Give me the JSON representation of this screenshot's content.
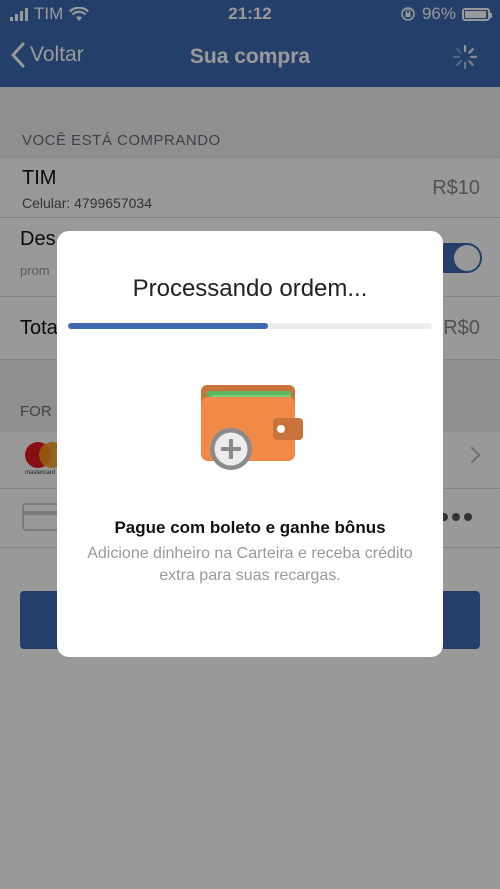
{
  "status_bar": {
    "carrier": "TIM",
    "time": "21:12",
    "battery": "96%"
  },
  "nav": {
    "back_label": "Voltar",
    "title": "Sua compra"
  },
  "purchase": {
    "section_header": "VOCÊ ESTÁ COMPRANDO",
    "product_title": "TIM",
    "product_subtitle": "Celular: 4799657034",
    "product_price": "R$10",
    "discount_title": "Des",
    "discount_subtitle": "prom",
    "total_title": "Tota",
    "total_value": "R$0"
  },
  "payment": {
    "section_header": "FOR",
    "card_brand_caption": "mastercard"
  },
  "modal": {
    "title": "Processando ordem...",
    "progress": 0.55,
    "promo_title": "Pague com boleto e ganhe bônus",
    "promo_text": "Adicione dinheiro na Carteira e receba crédito extra para suas recargas."
  },
  "colors": {
    "brand": "#3d6ab0",
    "wallet_orange": "#f08a47",
    "wallet_green": "#5bb85d"
  }
}
